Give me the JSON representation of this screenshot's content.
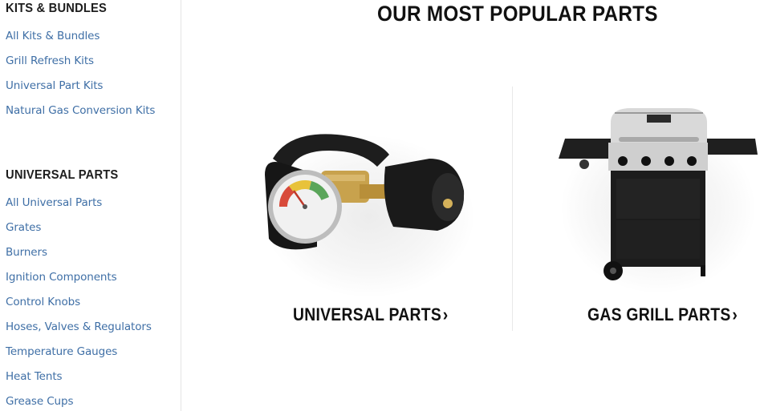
{
  "sidebar": {
    "kits_heading": "KITS & BUNDLES",
    "kits_items": [
      "All Kits & Bundles",
      "Grill Refresh Kits",
      "Universal Part Kits",
      "Natural Gas Conversion Kits"
    ],
    "universal_heading": "UNIVERSAL PARTS",
    "universal_items": [
      "All Universal Parts",
      "Grates",
      "Burners",
      "Ignition Components",
      "Control Knobs",
      "Hoses, Valves & Regulators",
      "Temperature Gauges",
      "Heat Tents",
      "Grease Cups"
    ]
  },
  "main": {
    "title": "OUR MOST POPULAR PARTS",
    "tiles": [
      {
        "label": "UNIVERSAL PARTS",
        "chevron": "›",
        "image": "propane-gauge-adapter"
      },
      {
        "label": "GAS GRILL PARTS",
        "chevron": "›",
        "image": "gas-grill"
      }
    ]
  },
  "colors": {
    "link": "#3f6fa6",
    "heading": "#1e1e1e",
    "text": "#111111"
  }
}
